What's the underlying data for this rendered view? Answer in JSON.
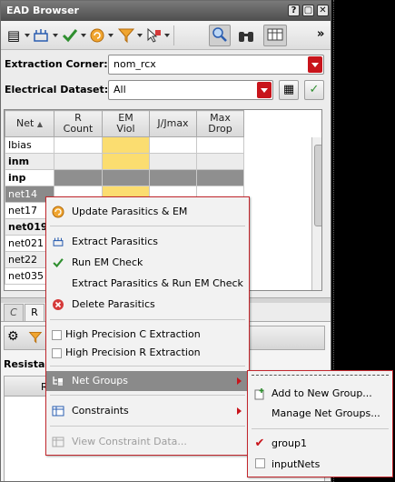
{
  "window": {
    "title": "EAD Browser",
    "title_buttons": [
      "?",
      "▢",
      "✕"
    ]
  },
  "toolbar": {
    "overflow": "»",
    "icons": [
      "document-menu-icon",
      "extract-icon",
      "check-icon",
      "refresh-icon",
      "filter-icon",
      "probe-icon",
      "zoom-icon",
      "binoculars-icon",
      "table-icon"
    ]
  },
  "extraction_corner": {
    "label": "Extraction Corner:",
    "value": "nom_rcx"
  },
  "electrical_dataset": {
    "label": "Electrical Dataset:",
    "value": "All"
  },
  "table": {
    "columns": [
      "Net",
      "R\nCount",
      "EM\nViol",
      "J/Jmax",
      "Max\nDrop"
    ],
    "rows": [
      {
        "net": "Ibias",
        "bold": false,
        "em": "yellow"
      },
      {
        "net": "inm",
        "bold": true,
        "em": "yellow"
      },
      {
        "net": "inp",
        "bold": true,
        "em": "dark"
      },
      {
        "net": "net14",
        "bold": false,
        "em": "yellow",
        "selected": true
      },
      {
        "net": "net17",
        "bold": false
      },
      {
        "net": "net019",
        "bold": true
      },
      {
        "net": "net021",
        "bold": false
      },
      {
        "net": "net22",
        "bold": false
      },
      {
        "net": "net035",
        "bold": false
      }
    ]
  },
  "lower_panel": {
    "tabs": [
      "C",
      "R"
    ],
    "section_label": "Resistar",
    "subheader": "R"
  },
  "context_menu": {
    "items": [
      {
        "label": "Update Parasitics & EM",
        "icon": "update-icon",
        "enabled": true
      },
      {
        "label": "Extract Parasitics",
        "icon": "extract-icon",
        "enabled": true
      },
      {
        "label": "Run EM Check",
        "icon": "check-icon",
        "enabled": true
      },
      {
        "label": "Extract Parasitics & Run EM Check",
        "icon": "",
        "enabled": true
      },
      {
        "label": "Delete Parasitics",
        "icon": "delete-icon",
        "enabled": true
      },
      {
        "label": "High Precision C Extraction",
        "checkbox": true,
        "enabled": true
      },
      {
        "label": "High Precision R Extraction",
        "checkbox": true,
        "enabled": true
      },
      {
        "label": "Net Groups",
        "icon": "net-groups-icon",
        "enabled": true,
        "submenu": true,
        "highlighted": true
      },
      {
        "label": "Constraints",
        "icon": "constraints-icon",
        "enabled": true,
        "submenu": true
      },
      {
        "label": "View Constraint Data...",
        "icon": "view-data-icon",
        "enabled": false
      }
    ]
  },
  "net_groups_submenu": {
    "items": [
      {
        "label": "Add to New Group...",
        "icon": "add-group-icon"
      },
      {
        "label": "Manage Net Groups...",
        "icon": ""
      },
      {
        "label": "group1",
        "checked": true
      },
      {
        "label": "inputNets",
        "checked": false
      }
    ]
  },
  "colors": {
    "accent": "#c8141b",
    "em_violation": "#fbdd70",
    "selection": "#8a8a8a"
  }
}
